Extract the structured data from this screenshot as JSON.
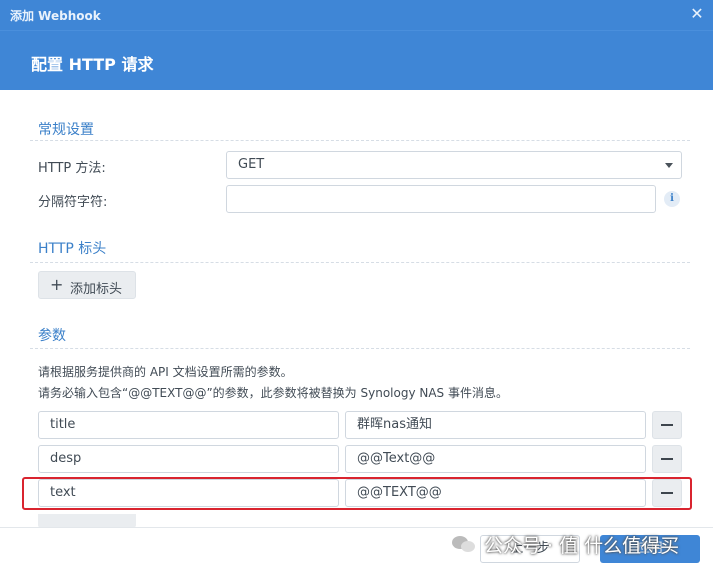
{
  "window": {
    "title": "添加 Webhook",
    "close_icon": "close-icon"
  },
  "header": {
    "title": "配置 HTTP 请求"
  },
  "general": {
    "title": "常规设置",
    "method_label": "HTTP 方法:",
    "method_value": "GET",
    "separator_label": "分隔符字符:",
    "separator_value": "",
    "info_icon": "info-icon",
    "info_glyph": "i"
  },
  "headers": {
    "title": "HTTP 标头",
    "add_label": "添加标头"
  },
  "params": {
    "title": "参数",
    "desc1": "请根据服务提供商的 API 文档设置所需的参数。",
    "desc2": "请务必输入包含“@@TEXT@@”的参数，此参数将被替换为 Synology NAS 事件消息。",
    "rows": [
      {
        "key": "title",
        "value": "群晖nas通知"
      },
      {
        "key": "desp",
        "value": "@@Text@@"
      },
      {
        "key": "text",
        "value": "@@TEXT@@"
      }
    ]
  },
  "footer": {
    "prev_label": "上一步",
    "apply_label": "应用"
  },
  "watermark": {
    "text": "公众号 · 值 什么值得买"
  },
  "colors": {
    "accent": "#3f86d6",
    "highlight": "#d9242f",
    "section": "#3b80c9"
  }
}
